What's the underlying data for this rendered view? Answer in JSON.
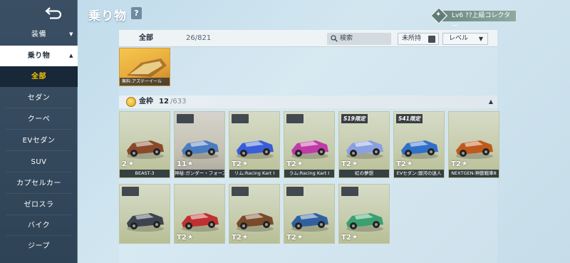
{
  "sidebar": {
    "items": [
      {
        "label": "装備",
        "caret": "▼"
      },
      {
        "label": "乗り物",
        "caret": "▲"
      },
      {
        "label": "全部"
      },
      {
        "label": "セダン"
      },
      {
        "label": "クーペ"
      },
      {
        "label": "EVセダン"
      },
      {
        "label": "SUV"
      },
      {
        "label": "カプセルカー"
      },
      {
        "label": "ゼロスラ"
      },
      {
        "label": "バイク"
      },
      {
        "label": "ジープ"
      }
    ]
  },
  "header": {
    "title": "乗り物",
    "help": "?",
    "rank_badge": "Lv6 ??上級コレクター"
  },
  "filter": {
    "tab_label": "全部",
    "count": "26/821",
    "search_placeholder": "検索",
    "owned_label": "未所持",
    "level_label": "レベル",
    "level_chevron": "▼"
  },
  "top_card": {
    "name": "無料:アズテーイール"
  },
  "section": {
    "title": "金枠",
    "owned": "12",
    "total": "/633",
    "collapse": "▲"
  },
  "cards": [
    {
      "tier": "2",
      "tag": "",
      "logo": false,
      "caption": "BEAST-3",
      "color": "#8a4a2a"
    },
    {
      "tier": "11",
      "tag": "",
      "logo": true,
      "caption": "神秘:ガンダー・フォース！",
      "color": "#4a7cc0"
    },
    {
      "tier": "T2",
      "tag": "",
      "logo": true,
      "caption": "リム:Racing Kart Ⅰ",
      "color": "#3a5dd8"
    },
    {
      "tier": "T2",
      "tag": "",
      "logo": true,
      "caption": "ラム:Racing Kart Ⅰ",
      "color": "#c03aa8"
    },
    {
      "tier": "T2",
      "tag": "S19限定",
      "logo": false,
      "caption": "虹の夢想",
      "color": "#8aa0e0"
    },
    {
      "tier": "T2",
      "tag": "S41限定",
      "logo": false,
      "caption": "EVセダン:銀河の迷人",
      "color": "#3070c8"
    },
    {
      "tier": "T2",
      "tag": "",
      "logo": false,
      "caption": "NEXTGEN:神獣戦車8",
      "color": "#c05a1c"
    },
    {
      "tier": "",
      "tag": "",
      "logo": true,
      "caption": "",
      "color": "#3c4450"
    },
    {
      "tier": "T2",
      "tag": "",
      "logo": false,
      "caption": "",
      "color": "#c03030"
    },
    {
      "tier": "T2",
      "tag": "",
      "logo": true,
      "caption": "",
      "color": "#7a4a2a"
    },
    {
      "tier": "T2",
      "tag": "",
      "logo": true,
      "caption": "",
      "color": "#3060a0"
    },
    {
      "tier": "T2",
      "tag": "",
      "logo": true,
      "caption": "",
      "color": "#3aa070"
    }
  ],
  "colors": {
    "sidebar_bg": "#34495e",
    "accent_yellow": "#f5c400",
    "card_gold": "#c7cdaf"
  }
}
